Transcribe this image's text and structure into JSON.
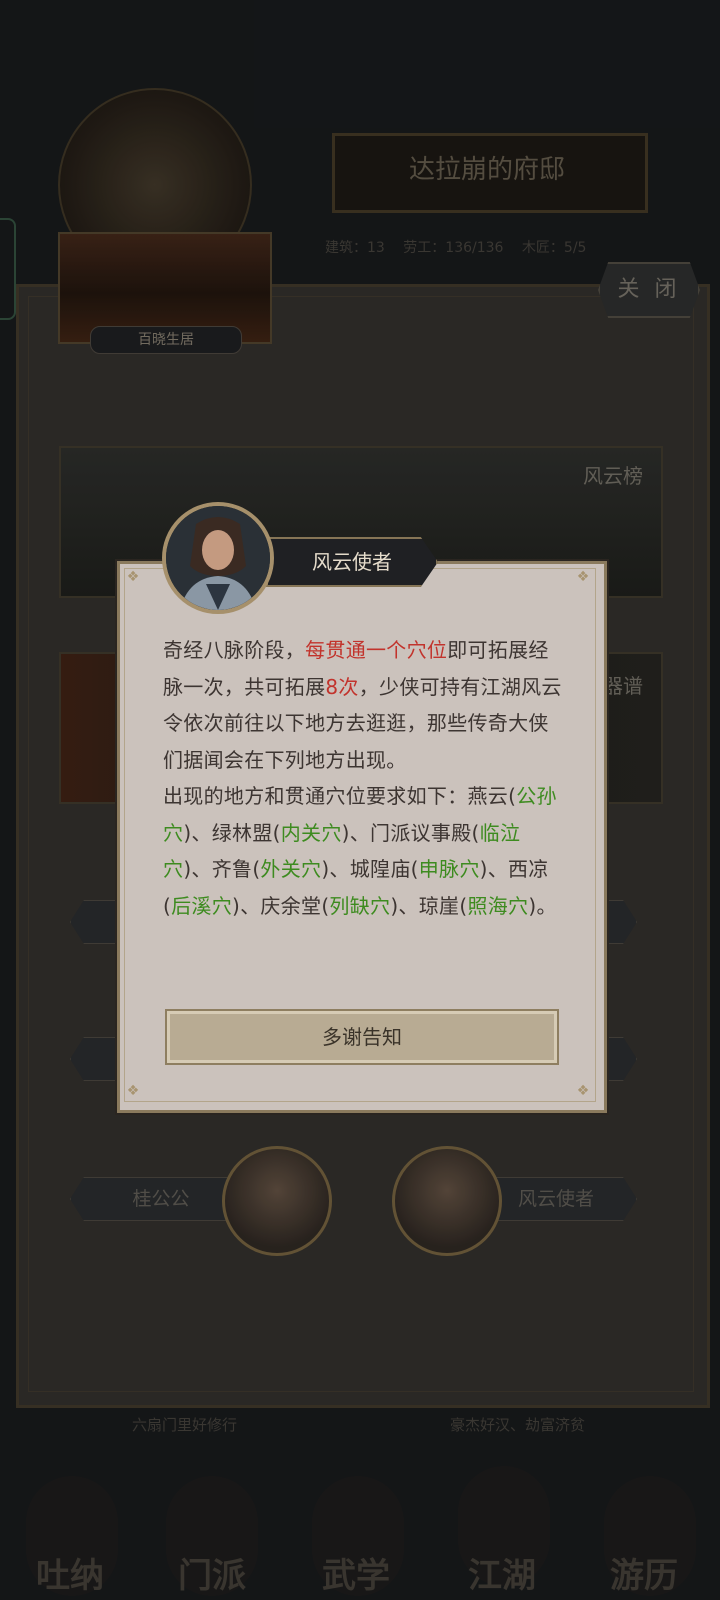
{
  "header": {
    "residence_title": "达拉崩的府邸",
    "stats": [
      "建筑：13",
      "劳工：136/136",
      "木匠：5/5"
    ],
    "close_label": "关 闭"
  },
  "thumbnail": {
    "label": "百晓生居"
  },
  "banners": [
    {
      "label": "风云榜"
    },
    {
      "label": "器谱"
    }
  ],
  "npcs": {
    "left_label": "桂公公",
    "right_label": "风云使者"
  },
  "footer": {
    "left_text": "六扇门里好修行",
    "right_text": "豪杰好汉、劫富济贫"
  },
  "bottom_nav": [
    {
      "label": "吐纳",
      "icon": "meditation-icon"
    },
    {
      "label": "门派",
      "icon": "sect-icon"
    },
    {
      "label": "武学",
      "icon": "martial-arts-icon"
    },
    {
      "label": "江湖",
      "icon": "jianghu-icon"
    },
    {
      "label": "游历",
      "icon": "travel-icon"
    }
  ],
  "dialog": {
    "speaker": "风云使者",
    "text": {
      "p1_a": "奇经八脉阶段，",
      "p1_red1": "每贯通一个穴位",
      "p1_b": "即可拓展经脉一次，共可拓展",
      "p1_red2": "8次",
      "p1_c": "，少侠可持有江湖风云令依次前往以下地方去逛逛，那些传奇大侠们据闻会在下列地方出现。",
      "p2_a": "出现的地方和贯通穴位要求如下：燕云(",
      "g1": "公孙穴",
      "p2_b": ")、绿林盟(",
      "g2": "内关穴",
      "p2_c": ")、门派议事殿(",
      "g3": "临泣穴",
      "p2_d": ")、齐鲁(",
      "g4": "外关穴",
      "p2_e": ")、城隍庙(",
      "g5": "申脉穴",
      "p2_f": ")、西凉(",
      "g6": "后溪穴",
      "p2_g": ")、庆余堂(",
      "g7": "列缺穴",
      "p2_h": ")、琼崖(",
      "g8": "照海穴",
      "p2_i": ")。"
    },
    "ack_label": "多谢告知"
  },
  "colors": {
    "highlight_red": "#c2332c",
    "highlight_green": "#3d8b1f",
    "dialog_bg": "#cbc2bc"
  }
}
